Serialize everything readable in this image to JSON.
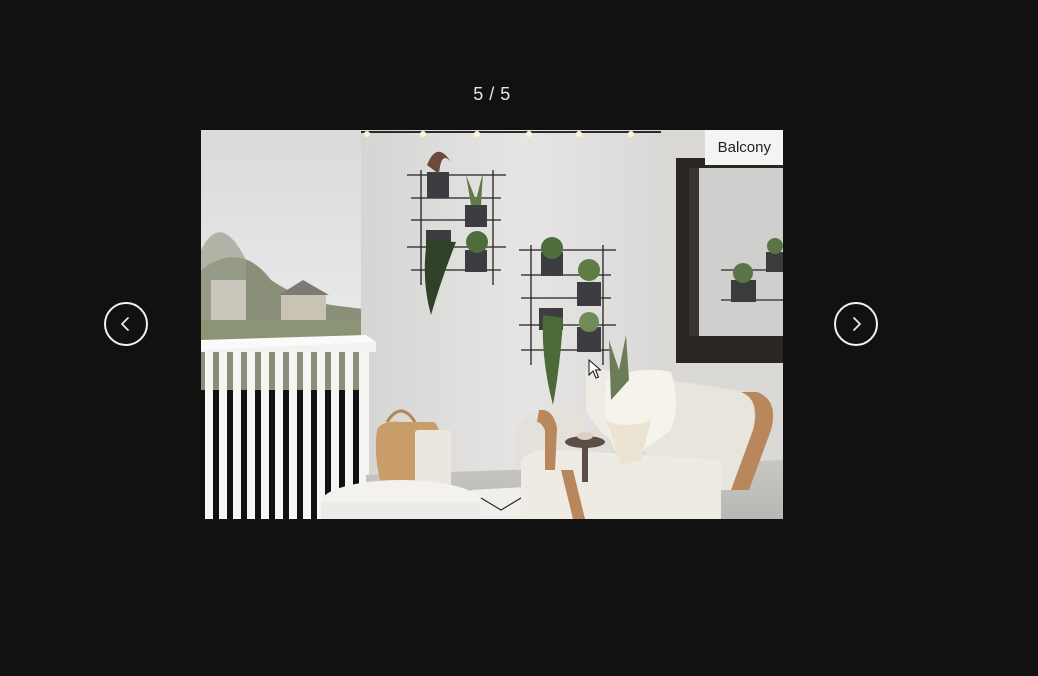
{
  "viewer": {
    "counter": "5 / 5"
  },
  "photo": {
    "tag_label": "Balcony"
  },
  "controls": {
    "prev_icon": "chevron-left-icon",
    "next_icon": "chevron-right-icon"
  },
  "colors": {
    "background": "#111112",
    "control_stroke": "#f2f2f2",
    "tag_background": "#f4f4f2"
  }
}
